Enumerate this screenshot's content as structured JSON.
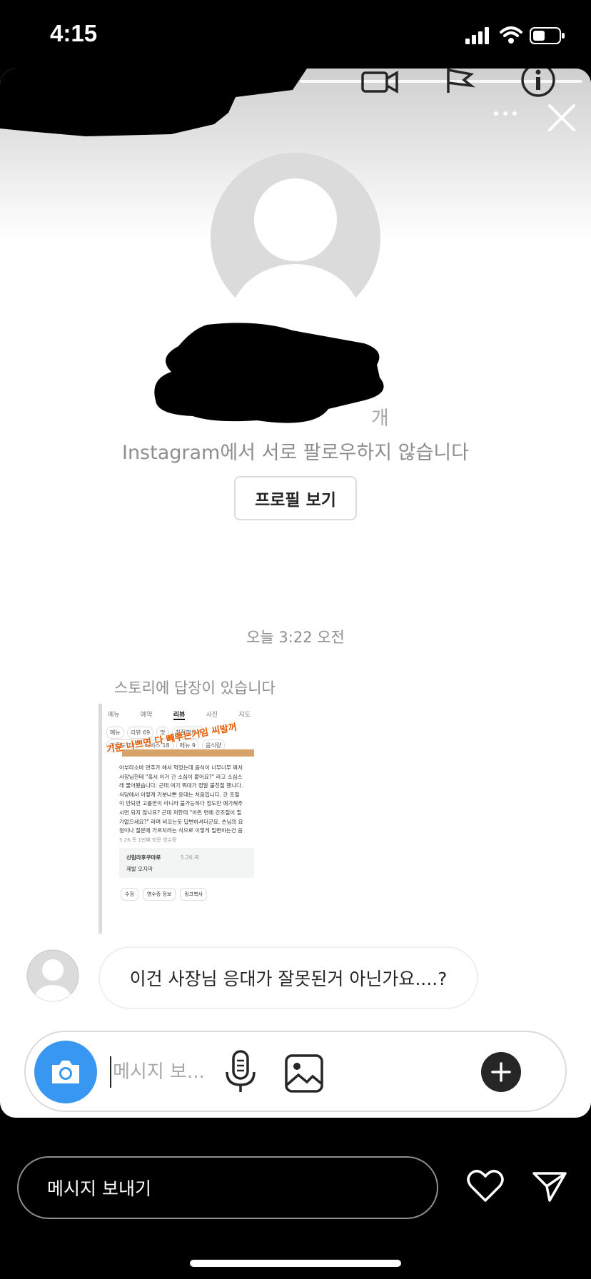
{
  "status_bar": {
    "time": "4:15"
  },
  "profile": {
    "follow_status": "Instagram에서 서로 팔로우하지 않습니다",
    "meta_fragment": "개",
    "view_profile_button": "프로필 보기"
  },
  "thread": {
    "timestamp": "오늘 3:22 오전",
    "story_reply_label": "스토리에 답장이 있습니다",
    "story_preview": {
      "tabs": [
        "메뉴",
        "예약",
        "리뷰",
        "사진",
        "지도"
      ],
      "active_tab": "리뷰",
      "chips": [
        "메뉴",
        "리뷰 69",
        "맛",
        "분위기",
        "친절해요 8",
        "고"
      ],
      "sub_chips": [
        "만족도 75",
        "서비스 18",
        "메뉴 9",
        "음식량"
      ],
      "overlay_text": "기분 나쁘면 다 빼뿌는거임 씨발꺼",
      "review_lines": [
        "아부라소바 면추가 해서 먹었는데 음식이 너무너무 짜서",
        "사장님한테 \"혹시 이거 간 소심이 붙어요?\" 라고 소심스",
        "레 물어봤습니다. 근데 여기 뭐대가 정말 불친절 했니다.",
        "식당에서 이렇게 기분나쁜 응대는 처음입니다. 간 조절",
        "이 안되면 고를면이 아니라 불가능하다 정도만 얘기해주",
        "시면 되지 않나요? 근데 저한테 \"이런 면에 간조절이 필",
        "가없으세요?\" 라며 비꼬는듯 답변하셔더군요. 손님의 요",
        "청이나 질문에 가르치려는 식으로 이렇게 밀변하는건 음",
        "식의 맛을 떠나서 정말 개선하셔야 한다고 생각합니다."
      ],
      "review_meta": "5.26.목  1번째 방문  영수증",
      "owner_reply_name": "신림라후쿠마루",
      "owner_reply_date": "5.26.목",
      "owner_reply_text": "제발 오지마",
      "actions": [
        "수정",
        "영수증 정보",
        "링크복사"
      ]
    },
    "message": "이건 사장님 응대가 잘못된거 아닌가요....?"
  },
  "composer": {
    "placeholder": "메시지 보..."
  },
  "story_footer": {
    "reply_placeholder": "메시지 보내기"
  },
  "colors": {
    "accent": "#3897f0",
    "text": "#262626",
    "muted": "#8e8e8e",
    "background": "#000000"
  },
  "icons": [
    "video-icon",
    "flag-icon",
    "info-icon",
    "more-icon",
    "close-icon",
    "camera-icon",
    "mic-icon",
    "gallery-icon",
    "plus-icon",
    "heart-icon",
    "send-icon"
  ]
}
